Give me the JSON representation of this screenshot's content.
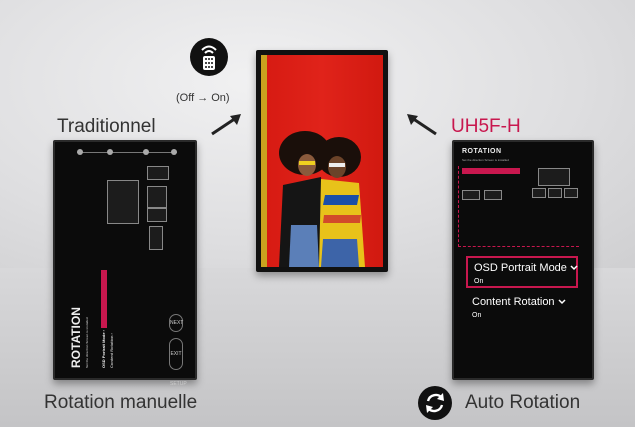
{
  "labels": {
    "traditional": "Traditionnel",
    "model": "UH5F-H",
    "manual_rotation": "Rotation manuelle",
    "auto_rotation": "Auto Rotation",
    "remote_caption": "(Off → On)"
  },
  "left_osd": {
    "title": "ROTATION",
    "subtitle": "Set the direction Screen is installed",
    "menu1": "OSD Portrait Mode ›",
    "menu2": "Content Rotation ›",
    "btn1": "NEXT",
    "btn2": "EXIT SETUP"
  },
  "right_osd": {
    "title": "ROTATION",
    "subtitle": "Set the direction Screen is installed"
  },
  "callout": {
    "option1_title": "OSD Portrait Mode",
    "option1_value": "On",
    "option2_title": "Content Rotation",
    "option2_value": "On"
  },
  "colors": {
    "brand": "#c8174e",
    "screen_red": "#d61a12",
    "text": "#333333"
  },
  "icons": [
    "remote-icon",
    "sync-icon",
    "chevron-down-icon",
    "arrow-icon"
  ]
}
